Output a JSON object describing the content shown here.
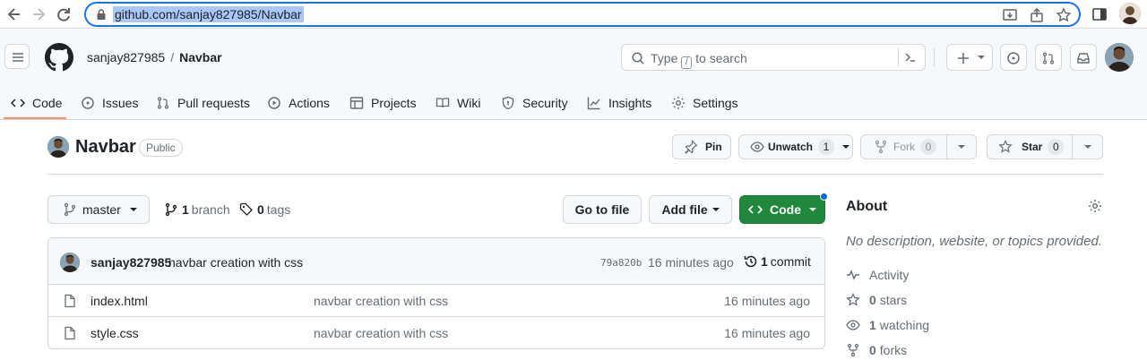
{
  "browser": {
    "url": "github.com/sanjay827985/Navbar"
  },
  "header": {
    "owner": "sanjay827985",
    "separator": "/",
    "repo": "Navbar",
    "search_prefix": "Type",
    "search_key": "/",
    "search_suffix": "to search"
  },
  "tabs": [
    {
      "label": "Code",
      "icon": "code-icon"
    },
    {
      "label": "Issues",
      "icon": "issue-icon"
    },
    {
      "label": "Pull requests",
      "icon": "pull-request-icon"
    },
    {
      "label": "Actions",
      "icon": "play-icon"
    },
    {
      "label": "Projects",
      "icon": "table-icon"
    },
    {
      "label": "Wiki",
      "icon": "book-icon"
    },
    {
      "label": "Security",
      "icon": "shield-icon"
    },
    {
      "label": "Insights",
      "icon": "graph-icon"
    },
    {
      "label": "Settings",
      "icon": "gear-icon"
    }
  ],
  "repo": {
    "name": "Navbar",
    "visibility": "Public",
    "pin_label": "Pin",
    "unwatch_label": "Unwatch",
    "unwatch_count": "1",
    "fork_label": "Fork",
    "fork_count": "0",
    "star_label": "Star",
    "star_count": "0"
  },
  "filenav": {
    "branch": "master",
    "branches_count": "1",
    "branches_label": "branch",
    "tags_count": "0",
    "tags_label": "tags",
    "go_to_file": "Go to file",
    "add_file": "Add file",
    "code": "Code"
  },
  "commit": {
    "author": "sanjay827985",
    "message": "navbar creation with css",
    "sha": "79a820b",
    "time": "16 minutes ago",
    "count": "1",
    "count_label": "commit"
  },
  "files": [
    {
      "name": "index.html",
      "message": "navbar creation with css",
      "time": "16 minutes ago"
    },
    {
      "name": "style.css",
      "message": "navbar creation with css",
      "time": "16 minutes ago"
    }
  ],
  "about": {
    "title": "About",
    "description": "No description, website, or topics provided.",
    "activity": "Activity",
    "stars_count": "0",
    "stars_label": "stars",
    "watching_count": "1",
    "watching_label": "watching",
    "forks_count": "0",
    "forks_label": "forks"
  },
  "colors": {
    "accent_green": "#1f883d",
    "url_highlight": "#a8c7fa",
    "tab_underline": "#fd8c73"
  }
}
